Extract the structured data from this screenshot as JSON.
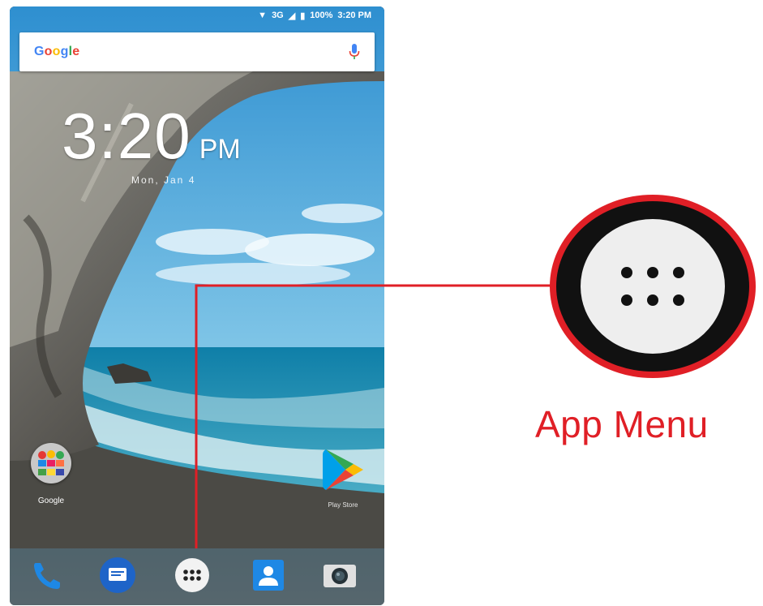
{
  "status_bar": {
    "network": "3G",
    "battery": "100%",
    "time": "3:20 PM"
  },
  "search_bar": {
    "logo": "Google"
  },
  "clock": {
    "time": "3:20",
    "ampm": "PM",
    "date": "Mon, Jan 4"
  },
  "home": {
    "folder_label": "Google",
    "play_store_label": "Play Store"
  },
  "dock": {
    "items": [
      "phone-icon",
      "messages-icon",
      "app-menu-icon",
      "contacts-icon",
      "camera-icon"
    ]
  },
  "callout": {
    "label": "App Menu",
    "color": "#e01f26"
  }
}
